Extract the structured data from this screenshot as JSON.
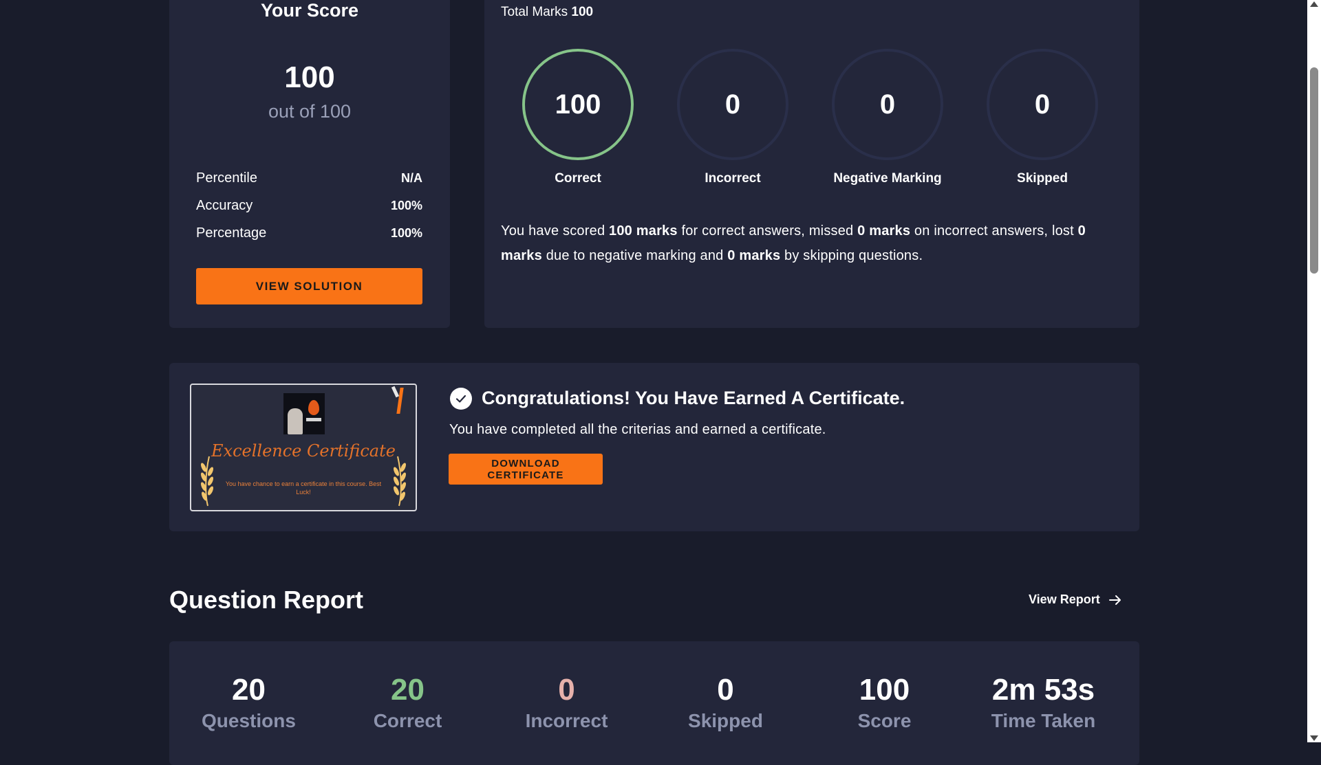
{
  "colors": {
    "background": "#191c2b",
    "card": "#23263a",
    "accent": "#f97316",
    "correct_green": "#86c489",
    "incorrect_pink": "#e6b1ab",
    "muted": "#8d93ad"
  },
  "score_card": {
    "title": "Your Score",
    "score": "100",
    "out_of": "out of 100",
    "stats": [
      {
        "label": "Percentile",
        "value": "N/A"
      },
      {
        "label": "Accuracy",
        "value": "100%"
      },
      {
        "label": "Percentage",
        "value": "100%"
      }
    ],
    "button_label": "VIEW SOLUTION"
  },
  "marks_card": {
    "total_label": "Total Marks",
    "total_value": "100",
    "circles": [
      {
        "value": "100",
        "label": "Correct",
        "fill_fraction": 1.0
      },
      {
        "value": "0",
        "label": "Incorrect",
        "fill_fraction": 0
      },
      {
        "value": "0",
        "label": "Negative Marking",
        "fill_fraction": 0
      },
      {
        "value": "0",
        "label": "Skipped",
        "fill_fraction": 0
      }
    ],
    "summary": {
      "t1": "You have scored ",
      "b1": "100 marks",
      "t2": " for correct answers, missed ",
      "b2": "0 marks",
      "t3": " on incorrect answers, lost ",
      "b3": "0 marks",
      "t4": " due to negative marking and ",
      "b4": "0 marks",
      "t5": " by skipping questions."
    }
  },
  "certificate": {
    "thumb_name": "Excellence Certificate",
    "thumb_description": "You have chance to earn a certificate in this course. Best Luck!",
    "icon": "check-circle-icon",
    "title": "Congratulations! You Have Earned A Certificate.",
    "subtitle": "You have completed all the criterias and earned a certificate.",
    "button_label": "DOWNLOAD CERTIFICATE"
  },
  "question_report": {
    "heading": "Question Report",
    "view_report_label": "View Report",
    "view_report_icon": "arrow-right-icon",
    "stats": [
      {
        "value": "20",
        "label": "Questions",
        "color": "#ffffff"
      },
      {
        "value": "20",
        "label": "Correct",
        "color": "#86c489"
      },
      {
        "value": "0",
        "label": "Incorrect",
        "color": "#e6b1ab"
      },
      {
        "value": "0",
        "label": "Skipped",
        "color": "#ffffff"
      },
      {
        "value": "100",
        "label": "Score",
        "color": "#ffffff"
      },
      {
        "value": "2m 53s",
        "label": "Time Taken",
        "color": "#ffffff"
      }
    ]
  }
}
